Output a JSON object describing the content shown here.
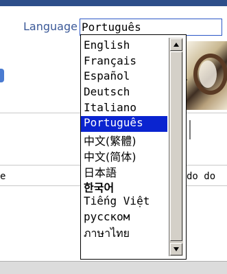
{
  "language": {
    "label": "Language",
    "selected_value": "Português",
    "options": [
      "English",
      "Français",
      "Español",
      "Deutsch",
      "Italiano",
      "Português",
      "中文(繁體)",
      "中文(简体)",
      "日本語",
      "한국어",
      "Tiếng Việt",
      "русском",
      "ภาษาไทย"
    ],
    "highlighted_index": 5
  },
  "background": {
    "column_header_left": "e",
    "column_header_right": "do do"
  },
  "scrollbar": {
    "up_icon": "triangle-up-icon",
    "down_icon": "triangle-down-icon"
  },
  "colors": {
    "label": "#3b5998",
    "select_border": "#2a56c6",
    "highlight": "#0a24d0"
  }
}
